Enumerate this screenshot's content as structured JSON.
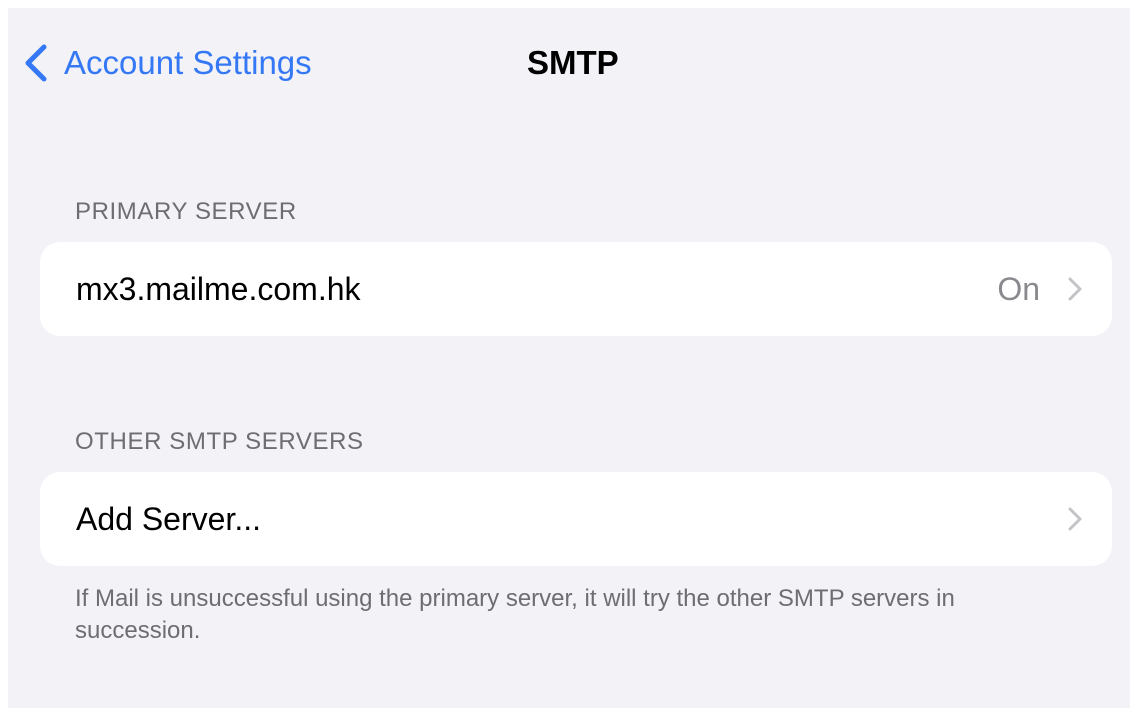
{
  "nav": {
    "back_label": "Account Settings",
    "title": "SMTP"
  },
  "primary": {
    "header": "PRIMARY SERVER",
    "server_name": "mx3.mailme.com.hk",
    "status": "On"
  },
  "other": {
    "header": "OTHER SMTP SERVERS",
    "add_label": "Add Server...",
    "footer": "If Mail is unsuccessful using the primary server, it will try the other SMTP servers in succession."
  },
  "icons": {
    "back": "chevron-left-icon",
    "disclosure": "chevron-right-icon"
  },
  "colors": {
    "accent": "#3478f6",
    "background": "#f2f2f7",
    "secondary_text": "#6d6d72",
    "value_text": "#8a8a8e",
    "chevron": "#c4c4c7"
  }
}
